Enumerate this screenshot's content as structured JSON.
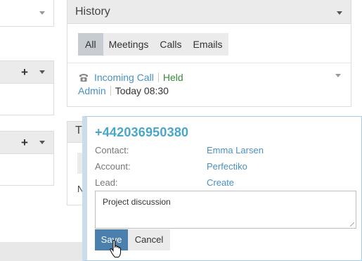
{
  "left_panels": {
    "panel2": {
      "add_icon": "plus-icon",
      "menu_icon": "caret-down-icon"
    },
    "panel3": {
      "add_icon": "plus-icon",
      "menu_icon": "caret-down-icon"
    }
  },
  "history": {
    "title": "History",
    "tabs": [
      {
        "label": "All",
        "active": true
      },
      {
        "label": "Meetings",
        "active": false
      },
      {
        "label": "Calls",
        "active": false
      },
      {
        "label": "Emails",
        "active": false
      }
    ],
    "entry": {
      "icon": "phone-icon",
      "type": "Incoming Call",
      "status": "Held",
      "user": "Admin",
      "time": "Today 08:30"
    }
  },
  "partial_panel": {
    "title_fragment": "T",
    "text_fragment": "N"
  },
  "popup": {
    "phone_number": "+442036950380",
    "fields": [
      {
        "label": "Contact:",
        "value": "Emma Larsen"
      },
      {
        "label": "Account:",
        "value": "Perfectiko"
      },
      {
        "label": "Lead:",
        "value": "Create"
      }
    ],
    "notes": "Project discussion",
    "save_label": "Save",
    "cancel_label": "Cancel"
  },
  "colors": {
    "link": "#4a90c2",
    "held": "#3a8a3a",
    "phone_number": "#4aa6c8",
    "save_button": "#4b7fae",
    "active_tab": "#c6ccd1"
  }
}
